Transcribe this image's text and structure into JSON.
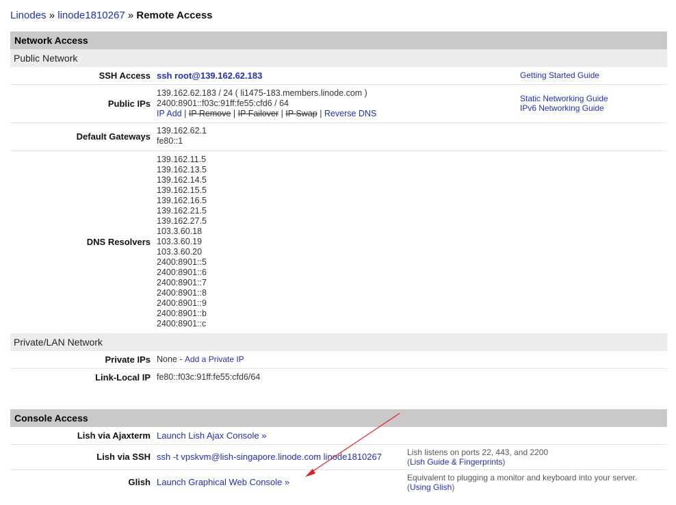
{
  "breadcrumb": {
    "items": [
      "Linodes",
      "linode1810267"
    ],
    "separator": "»",
    "current": "Remote Access"
  },
  "network_access": {
    "title": "Network Access",
    "public_network": "Public Network",
    "ssh_access": {
      "label": "SSH Access",
      "command": "ssh root@139.162.62.183",
      "guide": "Getting Started Guide"
    },
    "public_ips": {
      "label": "Public IPs",
      "ipv4": "139.162.62.183 / 24 ( li1475-183.members.linode.com )",
      "ipv6": "2400:8901::f03c:91ff:fe55:cfd6 / 64",
      "ip_add": "IP Add",
      "ip_remove": "IP Remove",
      "ip_failover": "IP Failover",
      "ip_swap": "IP Swap",
      "reverse_dns": "Reverse DNS",
      "pipe": "|",
      "static_guide": "Static Networking Guide",
      "ipv6_guide": "IPv6 Networking Guide"
    },
    "default_gateways": {
      "label": "Default Gateways",
      "values": [
        "139.162.62.1",
        "fe80::1"
      ]
    },
    "dns_resolvers": {
      "label": "DNS Resolvers",
      "values": [
        "139.162.11.5",
        "139.162.13.5",
        "139.162.14.5",
        "139.162.15.5",
        "139.162.16.5",
        "139.162.21.5",
        "139.162.27.5",
        "103.3.60.18",
        "103.3.60.19",
        "103.3.60.20",
        "2400:8901::5",
        "2400:8901::6",
        "2400:8901::7",
        "2400:8901::8",
        "2400:8901::9",
        "2400:8901::b",
        "2400:8901::c"
      ]
    },
    "private_network": "Private/LAN Network",
    "private_ips": {
      "label": "Private IPs",
      "value": "None - ",
      "add_link": "Add a Private IP"
    },
    "link_local": {
      "label": "Link-Local IP",
      "value": "fe80::f03c:91ff:fe55:cfd6/64"
    }
  },
  "console_access": {
    "title": "Console Access",
    "ajaxterm": {
      "label": "Lish via Ajaxterm",
      "link": "Launch Lish Ajax Console »"
    },
    "lish_ssh": {
      "label": "Lish via SSH",
      "command": "ssh -t vpskvm@lish-singapore.linode.com linode1810267",
      "note": "Lish listens on ports 22, 443, and 2200",
      "paren_open": "(",
      "guide": "Lish Guide & Fingerprints",
      "paren_close": ")"
    },
    "glish": {
      "label": "Glish",
      "link": "Launch Graphical Web Console »",
      "note": "Equivalent to plugging a monitor and keyboard into your server.",
      "paren_open": "(",
      "guide": "Using Glish",
      "paren_close": ")"
    }
  },
  "colors": {
    "link": "#2130b5",
    "section_header": "#c9c9c9",
    "sub_header": "#ececec",
    "annotation_arrow": "#e02020"
  }
}
